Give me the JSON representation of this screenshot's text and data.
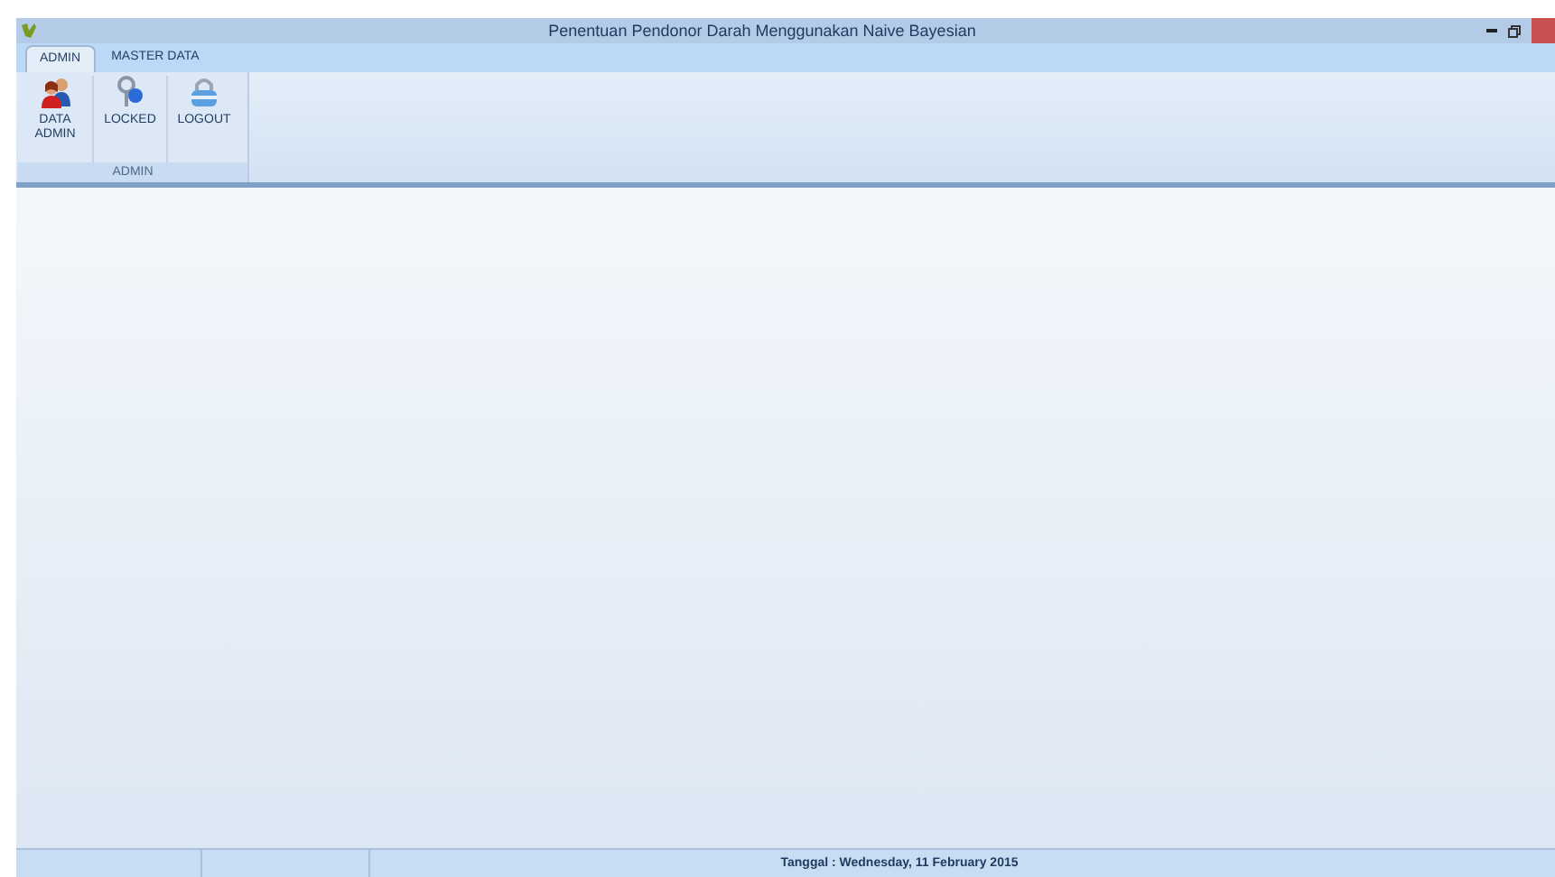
{
  "window": {
    "title": "Penentuan Pendonor Darah Menggunakan Naive Bayesian"
  },
  "tabs": [
    {
      "label": "ADMIN",
      "selected": true
    },
    {
      "label": "MASTER DATA",
      "selected": false
    }
  ],
  "ribbon": {
    "groups": [
      {
        "label": "ADMIN",
        "buttons": [
          {
            "label": "DATA ADMIN",
            "kind": "users"
          },
          {
            "label": "LOCKED",
            "kind": "keys"
          },
          {
            "label": "LOGOUT",
            "kind": "lock"
          }
        ]
      }
    ]
  },
  "status_bar": {
    "text": "Tanggal : Wednesday, 11 February 2015"
  }
}
